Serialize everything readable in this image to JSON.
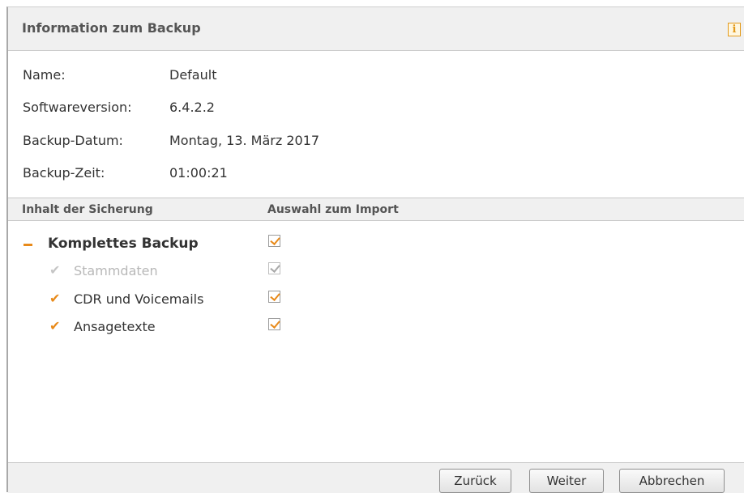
{
  "dialog": {
    "title": "Information zum Backup",
    "info_icon": "i"
  },
  "info": [
    {
      "label": "Name:",
      "value": "Default"
    },
    {
      "label": "Softwareversion:",
      "value": "6.4.2.2"
    },
    {
      "label": "Backup-Datum:",
      "value": "Montag, 13. März 2017"
    },
    {
      "label": "Backup-Zeit:",
      "value": "01:00:21"
    }
  ],
  "table": {
    "col_content": "Inhalt der Sicherung",
    "col_select": "Auswahl zum Import"
  },
  "tree": {
    "parent": {
      "label": "Komplettes Backup",
      "checked": true
    },
    "children": [
      {
        "label": "Stammdaten",
        "checked": true,
        "disabled": true
      },
      {
        "label": "CDR und Voicemails",
        "checked": true,
        "disabled": false
      },
      {
        "label": "Ansagetexte",
        "checked": true,
        "disabled": false
      }
    ]
  },
  "buttons": {
    "back": "Zurück",
    "next": "Weiter",
    "cancel": "Abbrechen"
  },
  "colors": {
    "accent": "#e88a1a",
    "header_bg": "#f0f0f0"
  }
}
